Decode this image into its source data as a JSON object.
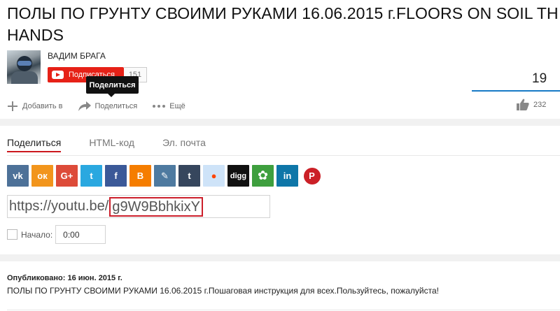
{
  "video": {
    "title_line1": "ПОЛЫ ПО ГРУНТУ СВОИМИ РУКАМИ 16.06.2015 г.FLOORS ON SOIL TH",
    "title_line2": "HANDS",
    "views": "19"
  },
  "channel": {
    "name": "ВАДИМ БРАГА",
    "subscribe_label": "Подписаться",
    "subscriber_count": "151"
  },
  "tooltip": {
    "text": "Поделиться"
  },
  "actions": {
    "add_label": "Добавить в",
    "share_label": "Поделиться",
    "more_label": "Ещё",
    "likes": "232"
  },
  "share_tabs": [
    {
      "label": "Поделиться",
      "active": true
    },
    {
      "label": "HTML-код",
      "active": false
    },
    {
      "label": "Эл. почта",
      "active": false
    }
  ],
  "social": [
    {
      "name": "vk",
      "glyph": "vk",
      "color": "#4d7198"
    },
    {
      "name": "odnoklassniki",
      "glyph": "ок",
      "color": "#f2951c"
    },
    {
      "name": "google-plus",
      "glyph": "G+",
      "color": "#dd4b39"
    },
    {
      "name": "twitter",
      "glyph": "t",
      "color": "#2aa8e0"
    },
    {
      "name": "facebook",
      "glyph": "f",
      "color": "#3b5998"
    },
    {
      "name": "blogger",
      "glyph": "B",
      "color": "#f57d00"
    },
    {
      "name": "livejournal",
      "glyph": "✎",
      "color": "#4e7aa0"
    },
    {
      "name": "tumblr",
      "glyph": "t",
      "color": "#36465d"
    },
    {
      "name": "reddit",
      "glyph": "●",
      "color": "#cee3f8"
    },
    {
      "name": "digg",
      "glyph": "digg",
      "color": "#111111"
    },
    {
      "name": "mixi",
      "glyph": "✿",
      "color": "#3e9f3e"
    },
    {
      "name": "linkedin",
      "glyph": "in",
      "color": "#0e76a8"
    },
    {
      "name": "pinterest",
      "glyph": "P",
      "color": "#cb2027"
    }
  ],
  "share_url": {
    "base": "https://youtu.be/",
    "id": "g9W9BbhkixY"
  },
  "start": {
    "label": "Начало:",
    "time": "0:00",
    "checked": false
  },
  "description": {
    "published": "Опубликовано: 16 июн. 2015 г.",
    "text": "ПОЛЫ ПО ГРУНТУ СВОИМИ РУКАМИ 16.06.2015 г.Пошаговая инструкция для всех.Пользуйтесь, пожалуйста!"
  }
}
